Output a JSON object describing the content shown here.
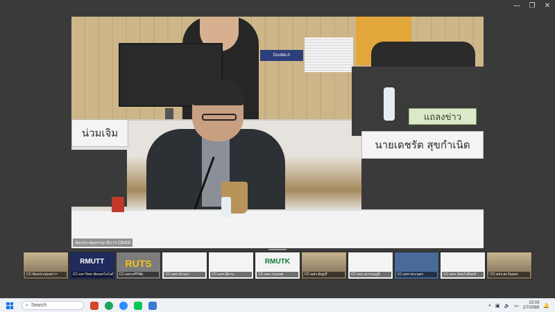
{
  "window": {
    "minimize": "—",
    "restore": "❐",
    "close": "✕"
  },
  "main_video": {
    "nameplate_left": "น่วมเจิม",
    "nameplate_right": "นายเดชรัต  สุขกำเนิด",
    "nameplate_green": "แถลงข่าว",
    "bluebox_text": "Double A",
    "caption": "ห้องประชุมกรรมาธิการ CB405"
  },
  "thumbnails": [
    {
      "label": "CC-ห้องประชุมสภาฯ",
      "logo": ""
    },
    {
      "label": "CC-มหาวิทยาลัยเทคโนโลยีฯ",
      "logo": "RMUTT"
    },
    {
      "label": "CC-มทร.ศรีวิชัย",
      "logo": "RUTS"
    },
    {
      "label": "CC-มทร.ล้านนา",
      "logo": ""
    },
    {
      "label": "CC-มทร.อีสาน",
      "logo": ""
    },
    {
      "label": "CC-มทร.กรุงเทพ",
      "logo": "RMUTK"
    },
    {
      "label": "CC-มทร.ธัญบุรี",
      "logo": ""
    },
    {
      "label": "CC-มทร.สุวรรณภูมิ",
      "logo": ""
    },
    {
      "label": "CC-มทร.พระนคร",
      "logo": ""
    },
    {
      "label": "CC-มทร.รัตนโกสินทร์",
      "logo": ""
    },
    {
      "label": "CC-มทร.ตะวันออก",
      "logo": ""
    }
  ],
  "taskbar": {
    "search_placeholder": "Search",
    "time": "15:03",
    "date": "2/7/2568"
  }
}
